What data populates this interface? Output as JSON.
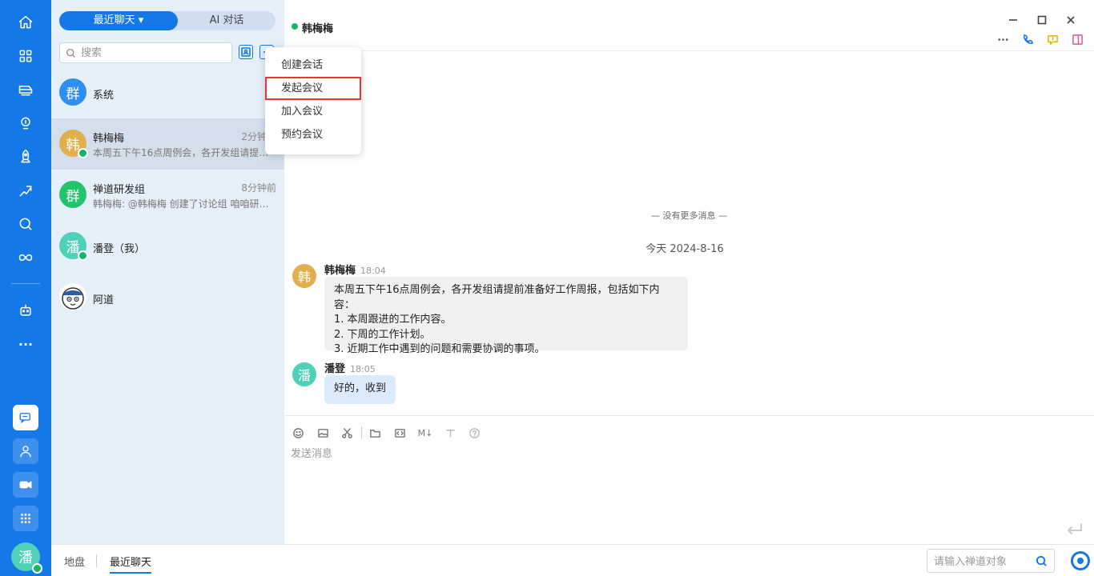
{
  "rail": {
    "icons": [
      "home-icon",
      "apps-grid-icon",
      "train-icon",
      "lightbulb-icon",
      "rocket-icon",
      "running-icon",
      "search-circle-icon",
      "infinity-icon",
      "robot-icon",
      "more-icon"
    ],
    "more_label": "···",
    "bottom": [
      "chat-icon",
      "contacts-icon",
      "video-icon",
      "app-grid-icon"
    ],
    "avatar_text": "潘"
  },
  "list": {
    "tabs": {
      "recent": "最近聊天",
      "ai": "AI 对话"
    },
    "search_placeholder": "搜索",
    "conversations": [
      {
        "avatar_text": "群",
        "avatar_color": "#2e8ff0",
        "name": "系统",
        "time": "",
        "preview": ""
      },
      {
        "avatar_text": "韩",
        "avatar_color": "#e0b04f",
        "name": "韩梅梅",
        "time": "2分钟前",
        "preview": "本周五下午16点周例会，各开发组请提前准备好工作周报，包括如下内容"
      },
      {
        "avatar_text": "群",
        "avatar_color": "#22c46e",
        "name": "禅道研发组",
        "time": "8分钟前",
        "preview": "韩梅梅: @韩梅梅 创建了讨论组 咱咱研发组"
      },
      {
        "avatar_text": "潘",
        "avatar_color": "#4fd1b8",
        "name": "潘登（我）",
        "time": "",
        "preview": ""
      },
      {
        "avatar_text": "",
        "avatar_color": "#ffffff",
        "name": "阿道",
        "time": "",
        "preview": ""
      }
    ]
  },
  "menu": {
    "items": [
      "创建会话",
      "发起会议",
      "加入会议",
      "预约会议"
    ]
  },
  "chat": {
    "title": "韩梅梅",
    "no_more": "— 没有更多消息 —",
    "date": "今天 2024-8-16",
    "messages": [
      {
        "avatar_text": "韩",
        "avatar_color": "#e0b04f",
        "name": "韩梅梅",
        "time": "18:04",
        "lines": [
          "本周五下午16点周例会，各开发组请提前准备好工作周报，包括如下内容：",
          "1. 本周跟进的工作内容。",
          "2. 下周的工作计划。",
          "3. 近期工作中遇到的问题和需要协调的事项。"
        ]
      },
      {
        "avatar_text": "潘",
        "avatar_color": "#4fd1b8",
        "name": "潘登",
        "time": "18:05",
        "lines": [
          "好的，收到"
        ]
      }
    ],
    "composer_placeholder": "发送消息",
    "markdown_label": "M↓"
  },
  "bottombar": {
    "tabs": [
      "地盘",
      "最近聊天"
    ],
    "search_placeholder": "请输入禅道对象"
  },
  "colors": {
    "accent": "#1478e8",
    "online": "#19b36b",
    "highlight": "#ee3333"
  }
}
